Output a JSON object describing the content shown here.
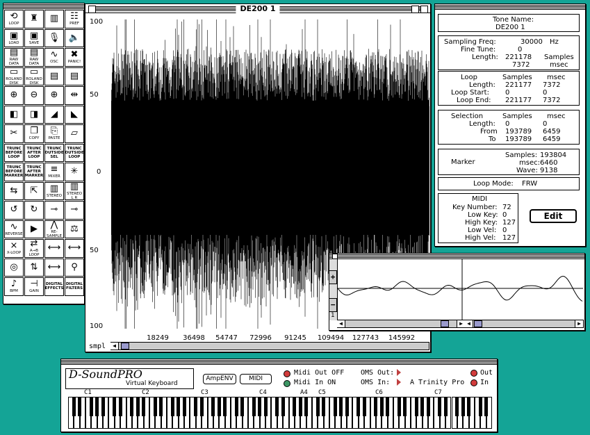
{
  "palette": {
    "tools": [
      {
        "label": "LOOP",
        "icon": "loop-icon"
      },
      {
        "label": "",
        "icon": "chess-piece-icon"
      },
      {
        "label": "",
        "icon": "piano-keys-icon"
      },
      {
        "label": "PREF",
        "icon": "preferences-icon"
      },
      {
        "label": "LOAD",
        "icon": "load-disk-icon"
      },
      {
        "label": "SAVE",
        "icon": "save-disk-icon"
      },
      {
        "label": "",
        "icon": "microphone-icon"
      },
      {
        "label": "",
        "icon": "speaker-icon"
      },
      {
        "label": "RAW DATA",
        "icon": "raw-data-load-icon"
      },
      {
        "label": "RAW DATA",
        "icon": "raw-data-save-icon"
      },
      {
        "label": "OSC",
        "icon": "oscillator-icon"
      },
      {
        "label": "PANIC!",
        "icon": "panic-icon"
      },
      {
        "label": "ROLAND DISK",
        "icon": "roland-disk-load-icon"
      },
      {
        "label": "ROLAND DISK",
        "icon": "roland-disk-save-icon"
      },
      {
        "label": "",
        "icon": "document-icon"
      },
      {
        "label": "",
        "icon": "document-copy-icon"
      },
      {
        "label": "",
        "icon": "zoom-in-icon"
      },
      {
        "label": "",
        "icon": "zoom-out-icon"
      },
      {
        "label": "",
        "icon": "zoom-selection-icon"
      },
      {
        "label": "",
        "icon": "fit-width-icon"
      },
      {
        "label": "",
        "icon": "select-left-icon"
      },
      {
        "label": "",
        "icon": "select-right-icon"
      },
      {
        "label": "",
        "icon": "fade-in-icon"
      },
      {
        "label": "",
        "icon": "fade-out-icon"
      },
      {
        "label": "",
        "icon": "cut-icon"
      },
      {
        "label": "COPY",
        "icon": "copy-icon"
      },
      {
        "label": "PASTE",
        "icon": "paste-icon"
      },
      {
        "label": "",
        "icon": "eraser-icon"
      },
      {
        "label": "TRUNC BEFORE LOOP",
        "icon": "truncate-before-loop-icon"
      },
      {
        "label": "TRUNC AFTER LOOP",
        "icon": "truncate-after-loop-icon"
      },
      {
        "label": "TRUNC OUTSIDE SEL",
        "icon": "truncate-outside-sel-icon"
      },
      {
        "label": "TRUNC OUTSIDE LOOP",
        "icon": "truncate-outside-loop-icon"
      },
      {
        "label": "TRUNC BEFORE MARKER",
        "icon": "truncate-before-marker-icon"
      },
      {
        "label": "TRUNC AFTER MARKER",
        "icon": "truncate-after-marker-icon"
      },
      {
        "label": "MIXER",
        "icon": "mixer-icon"
      },
      {
        "label": "",
        "icon": "marker-icon"
      },
      {
        "label": "",
        "icon": "swap-icon"
      },
      {
        "label": "",
        "icon": "expand-icon"
      },
      {
        "label": "STEREO",
        "icon": "stereo-icon"
      },
      {
        "label": "STEREO L R",
        "icon": "stereo-split-icon"
      },
      {
        "label": "",
        "icon": "loop-left-icon"
      },
      {
        "label": "",
        "icon": "loop-right-icon"
      },
      {
        "label": "",
        "icon": "cable-icon"
      },
      {
        "label": "",
        "icon": "cable-split-icon"
      },
      {
        "label": "REVERSE",
        "icon": "reverse-icon"
      },
      {
        "label": "",
        "icon": "play-icon"
      },
      {
        "label": "RE-SAMPLE",
        "icon": "resample-icon"
      },
      {
        "label": "",
        "icon": "balance-icon"
      },
      {
        "label": "X-LOOP",
        "icon": "crossfade-loop-icon"
      },
      {
        "label": "A→B LOOP",
        "icon": "a-b-loop-icon"
      },
      {
        "label": "",
        "icon": "loop-range-icon"
      },
      {
        "label": "",
        "icon": "loop-range-end-icon"
      },
      {
        "label": "",
        "icon": "shift-icon"
      },
      {
        "label": "",
        "icon": "shift-up-icon"
      },
      {
        "label": "",
        "icon": "loop-point-icon"
      },
      {
        "label": "",
        "icon": "tuning-icon"
      },
      {
        "label": "BPM",
        "icon": "bpm-icon"
      },
      {
        "label": "GAIN",
        "icon": "gain-icon"
      },
      {
        "label": "DIGITAL EFFECTS",
        "icon": "effects-icon"
      },
      {
        "label": "DIGITAL FILTERS",
        "icon": "filters-icon"
      }
    ]
  },
  "wave_window": {
    "title": "DE200 1",
    "y_labels": [
      "100",
      "50",
      "0",
      "50",
      "100"
    ],
    "x_labels": [
      "18249",
      "36498",
      "54747",
      "72996",
      "91245",
      "109494",
      "127743",
      "145992"
    ],
    "scroll_label": "smpl"
  },
  "info": {
    "tone_name_label": "Tone Name:",
    "tone_name": "DE200 1",
    "sampling_freq_label": "Sampling Freq:",
    "sampling_freq": "30000",
    "sampling_freq_unit": "Hz",
    "fine_tune_label": "Fine Tune:",
    "fine_tune": "0",
    "length_label": "Length:",
    "length_samples": "221178",
    "length_samples_unit": "Samples",
    "length_msec": "7372",
    "length_msec_unit": "msec",
    "loop": {
      "header": "Loop",
      "col1": "Samples",
      "col2": "msec",
      "rows": [
        {
          "label": "Length:",
          "samples": "221177",
          "msec": "7372"
        },
        {
          "label": "Loop Start:",
          "samples": "0",
          "msec": "0"
        },
        {
          "label": "Loop End:",
          "samples": "221177",
          "msec": "7372"
        }
      ]
    },
    "selection": {
      "header": "Selection",
      "col1": "Samples",
      "col2": "msec",
      "rows": [
        {
          "label": "Length:",
          "samples": "0",
          "msec": "0"
        },
        {
          "label": "From",
          "samples": "193789",
          "msec": "6459"
        },
        {
          "label": "To",
          "samples": "193789",
          "msec": "6459"
        }
      ]
    },
    "marker": {
      "label": "Marker",
      "samples_label": "Samples:",
      "samples": "193804",
      "msec_label": "msec:",
      "msec": "6460",
      "wave_label": "Wave:",
      "wave": "9138"
    },
    "loop_mode_label": "Loop Mode:",
    "loop_mode": "FRW",
    "midi": {
      "header": "MIDI",
      "rows": [
        {
          "label": "Key Number:",
          "value": "72"
        },
        {
          "label": "Low Key:",
          "value": "0"
        },
        {
          "label": "High Key:",
          "value": "127"
        },
        {
          "label": "Low Vel:",
          "value": "0"
        },
        {
          "label": "High Vel:",
          "value": "127"
        }
      ]
    },
    "edit_button": "Edit"
  },
  "zoom_window": {
    "plus": "+",
    "minus": "−",
    "value": "1"
  },
  "keyboard": {
    "brand": "D-SoundPRO",
    "subtitle": "Virtual Keyboard",
    "ampenv_button": "AmpENV",
    "midi_button": "MIDI",
    "midi_out": "Midi Out OFF",
    "midi_in": "Midi In ON",
    "oms_out": "OMS Out:",
    "oms_in": "OMS In:",
    "oms_in_device": "A Trinity Pro",
    "out_label": "Out",
    "in_label": "In",
    "octave_labels": [
      "C1",
      "C2",
      "C3",
      "C4",
      "A4",
      "C5",
      "C6",
      "C7"
    ],
    "colors": {
      "led_red": "#d23c3c",
      "led_green": "#3c9664"
    }
  },
  "colors": {
    "desktop": "#14a496",
    "scroll_thumb": "#9999cc"
  }
}
